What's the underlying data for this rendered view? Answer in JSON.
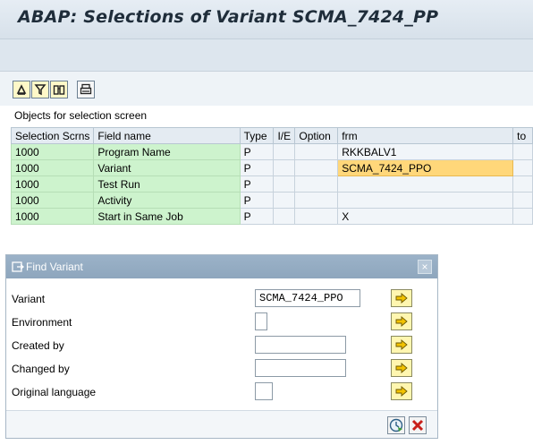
{
  "window": {
    "title": "ABAP: Selections of Variant SCMA_7424_PP"
  },
  "toolbar": {
    "buttons": [
      "filter-icon",
      "sort-icon",
      "find-icon",
      "print-icon"
    ]
  },
  "section": {
    "label": "Objects for selection screen"
  },
  "table": {
    "headers": [
      "Selection Scrns",
      "Field name",
      "Type",
      "I/E",
      "Option",
      "frm",
      "to"
    ],
    "rows": [
      {
        "screen": "1000",
        "field": "Program Name",
        "type": "P",
        "ie": "",
        "option": "",
        "frm": "RKKBALV1",
        "to": ""
      },
      {
        "screen": "1000",
        "field": "Variant",
        "type": "P",
        "ie": "",
        "option": "",
        "frm": "SCMA_7424_PPO",
        "to": ""
      },
      {
        "screen": "1000",
        "field": "Test Run",
        "type": "P",
        "ie": "",
        "option": "",
        "frm": "",
        "to": ""
      },
      {
        "screen": "1000",
        "field": "Activity",
        "type": "P",
        "ie": "",
        "option": "",
        "frm": "",
        "to": ""
      },
      {
        "screen": "1000",
        "field": "Start in Same Job",
        "type": "P",
        "ie": "",
        "option": "",
        "frm": "X",
        "to": ""
      }
    ]
  },
  "dialog": {
    "title": "Find Variant",
    "close": "×",
    "fields": [
      {
        "label": "Variant",
        "value": "SCMA_7424_PPO"
      },
      {
        "label": "Environment",
        "value": ""
      },
      {
        "label": "Created by",
        "value": ""
      },
      {
        "label": "Changed by",
        "value": ""
      },
      {
        "label": "Original language",
        "value": ""
      }
    ]
  },
  "colors": {
    "green_cell": "#cdf3cd",
    "highlight_cell": "#ffd77a",
    "dialog_title": "#9bb2c8"
  }
}
